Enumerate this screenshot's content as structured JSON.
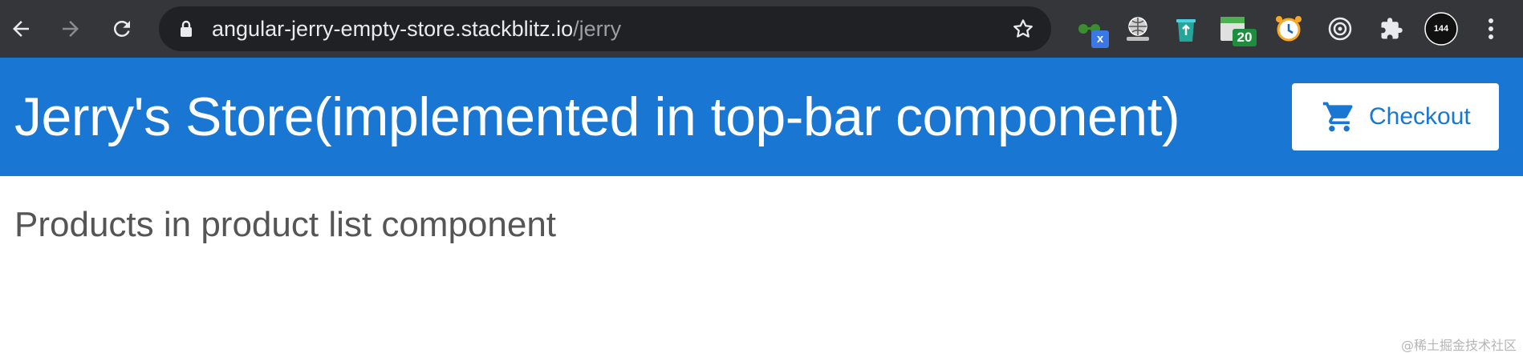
{
  "browser": {
    "url_host": "angular-jerry-empty-store.stackblitz.io",
    "url_path": "/jerry",
    "extensions": [
      {
        "icon": "glasses-extension-icon",
        "badge": "x",
        "badge_color": "#3b78e7"
      },
      {
        "icon": "globe-hand-extension-icon",
        "badge": ""
      },
      {
        "icon": "recycle-extension-icon",
        "badge": ""
      },
      {
        "icon": "window-extension-icon",
        "badge": "20",
        "badge_color": "#1e8e3e"
      },
      {
        "icon": "alarm-clock-extension-icon",
        "badge": ""
      },
      {
        "icon": "target-extension-icon",
        "badge": ""
      },
      {
        "icon": "puzzle-extensions-icon",
        "badge": ""
      },
      {
        "icon": "profile-avatar",
        "badge": "144"
      }
    ]
  },
  "topbar": {
    "title": "Jerry's Store(implemented in top-bar component)",
    "checkout_label": "Checkout",
    "background": "#1976d2"
  },
  "content": {
    "heading": "Products in product list component"
  },
  "watermark": "@稀土掘金技术社区"
}
